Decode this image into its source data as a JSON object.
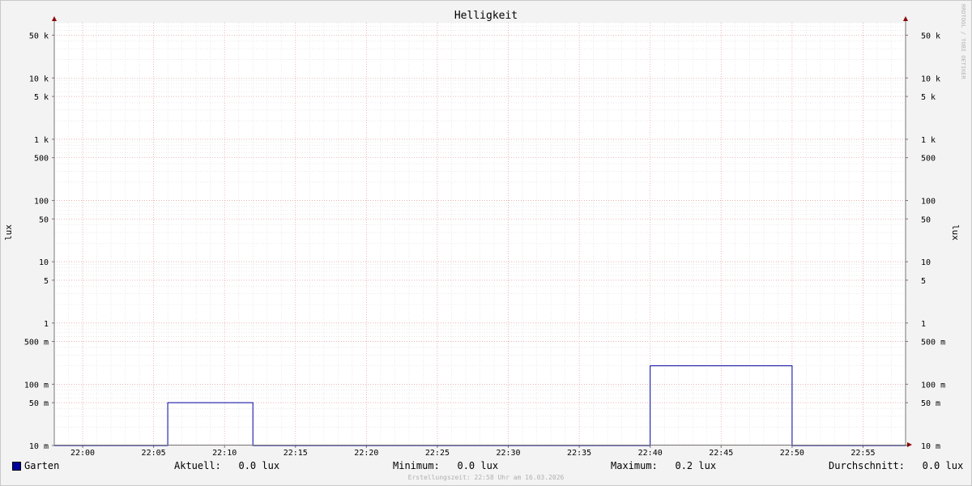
{
  "chart_data": {
    "type": "line",
    "title": "Helligkeit",
    "ylabel": "lux",
    "ylabel_right": "lux",
    "yscale": "log",
    "ylim": [
      0.01,
      80000
    ],
    "xlim": [
      "21:58",
      "22:58"
    ],
    "grid": true,
    "watermark": "RRDTOOL / TOBI OETIKER",
    "x_ticks": [
      "22:00",
      "22:05",
      "22:10",
      "22:15",
      "22:20",
      "22:25",
      "22:30",
      "22:35",
      "22:40",
      "22:45",
      "22:50",
      "22:55"
    ],
    "y_ticks": [
      {
        "value": 50000,
        "label": "50 k"
      },
      {
        "value": 10000,
        "label": "10 k"
      },
      {
        "value": 5000,
        "label": "5 k"
      },
      {
        "value": 1000,
        "label": "1 k"
      },
      {
        "value": 500,
        "label": "500"
      },
      {
        "value": 100,
        "label": "100"
      },
      {
        "value": 50,
        "label": "50"
      },
      {
        "value": 10,
        "label": "10"
      },
      {
        "value": 5,
        "label": "5"
      },
      {
        "value": 1,
        "label": "1"
      },
      {
        "value": 0.5,
        "label": "500 m"
      },
      {
        "value": 0.1,
        "label": "100 m"
      },
      {
        "value": 0.05,
        "label": "50 m"
      },
      {
        "value": 0.01,
        "label": "10 m"
      }
    ],
    "series": [
      {
        "name": "Garten",
        "color": "#00009c",
        "points": [
          [
            "21:58",
            0.0
          ],
          [
            "22:06",
            0.0
          ],
          [
            "22:06",
            0.05
          ],
          [
            "22:12",
            0.05
          ],
          [
            "22:12",
            0.0
          ],
          [
            "22:40",
            0.0
          ],
          [
            "22:40",
            0.2
          ],
          [
            "22:50",
            0.2
          ],
          [
            "22:50",
            0.0
          ],
          [
            "22:58",
            0.0
          ]
        ]
      }
    ]
  },
  "legend": {
    "series_name": "Garten",
    "current": "Aktuell:   0.0 lux",
    "minimum": "Minimum:   0.0 lux",
    "maximum": "Maximum:   0.2 lux",
    "average": "Durchschnitt:   0.0 lux"
  },
  "footer": "Erstellungszeit: 22:58 Uhr am 16.03.2026"
}
